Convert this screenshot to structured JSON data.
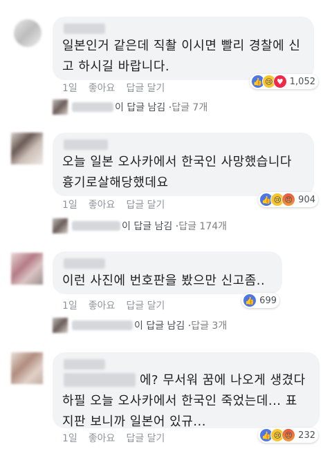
{
  "actions": {
    "time": "1일",
    "like": "좋아요",
    "reply": "답글 달기"
  },
  "comments": [
    {
      "text": "일본인거 같은데 직촬 이시면 빨리 경찰에 신\n고 하시길 바랍니다.",
      "reaction_count": "1,052",
      "reactions": [
        "like-icon",
        "sad-icon",
        "love-icon"
      ],
      "reply": {
        "text": "이 답글 남김 · ",
        "count": "답글 7개"
      }
    },
    {
      "text": "오늘 일본 오사카에서 한국인 사망했습니다\n흉기로살해당했데요",
      "reaction_count": "904",
      "reactions": [
        "like-icon",
        "sad-icon",
        "angry-icon"
      ],
      "reply": {
        "text": "이 답글 남김 · ",
        "count": "답글 174개"
      }
    },
    {
      "text": "이런 사진에 번호판을 봤으만 신고좀..",
      "reaction_count": "699",
      "reactions": [
        "like-icon"
      ],
      "reply": {
        "text": "이 답글 남김 · ",
        "count": "답글 3개"
      }
    },
    {
      "text": "에? 무서워 꿈에 나오게 생겼다\n하필 오늘 오사카에서 한국인 죽었는데... 표\n지판 보니까 일본어 있규...",
      "reaction_count": "232",
      "reactions": [
        "like-icon",
        "sad-icon",
        "angry-icon"
      ]
    }
  ]
}
